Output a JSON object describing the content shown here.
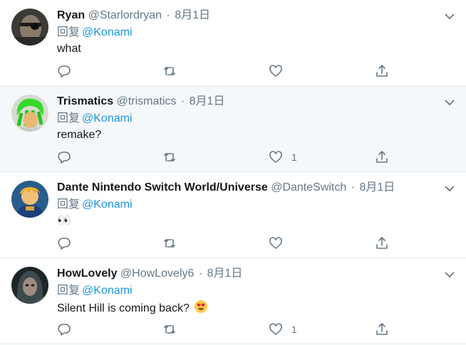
{
  "tweets": [
    {
      "name": "Ryan",
      "handle": "@Starlordryan",
      "separator": "·",
      "date": "8月1日",
      "reply_prefix": "回复",
      "reply_mention": "@Konami",
      "text": "what",
      "likes": ""
    },
    {
      "name": "Trismatics",
      "handle": "@trismatics",
      "separator": "·",
      "date": "8月1日",
      "reply_prefix": "回复",
      "reply_mention": "@Konami",
      "text": "remake?",
      "likes": "1"
    },
    {
      "name": "Dante Nintendo Switch World/Universe",
      "handle": "@DanteSwitch",
      "separator": "·",
      "date": "8月1日",
      "reply_prefix": "回复",
      "reply_mention": "@Konami",
      "text": "👀",
      "likes": ""
    },
    {
      "name": "HowLovely",
      "handle": "@HowLovely6",
      "separator": "·",
      "date": "8月1日",
      "reply_prefix": "回复",
      "reply_mention": "@Konami",
      "text": "Silent Hill is coming back?",
      "likes": "1"
    }
  ],
  "colors": {
    "accent": "#1b95e0",
    "muted": "#657786",
    "text": "#14171a",
    "highlight_bg": "#f5f8fa"
  },
  "icons": [
    "reply-icon",
    "retweet-icon",
    "like-icon",
    "share-icon",
    "chevron-down-icon"
  ]
}
